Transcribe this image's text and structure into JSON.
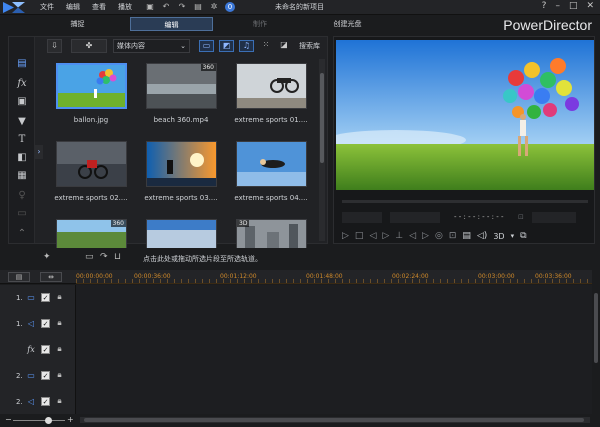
{
  "titlebar": {
    "menu": [
      "文件",
      "编辑",
      "查看",
      "播放"
    ],
    "project_title": "未命名的新项目",
    "window_buttons": [
      "?",
      "–",
      "□",
      "✕"
    ],
    "notification_count": "0"
  },
  "modes": {
    "tabs": [
      {
        "label": "捕捉",
        "state": "normal"
      },
      {
        "label": "编辑",
        "state": "active"
      },
      {
        "label": "制作",
        "state": "disabled"
      },
      {
        "label": "创建光盘",
        "state": "normal"
      }
    ],
    "brand": "PowerDirector"
  },
  "library": {
    "dropdown_value": "媒体内容",
    "search_label": "搜索库",
    "items": [
      {
        "label": "ballon.jpg",
        "badge": "",
        "selected": true
      },
      {
        "label": "beach 360.mp4",
        "badge": "360",
        "selected": false
      },
      {
        "label": "extreme sports 01....",
        "badge": "",
        "selected": false
      },
      {
        "label": "extreme sports 02....",
        "badge": "",
        "selected": false
      },
      {
        "label": "extreme sports 03....",
        "badge": "",
        "selected": false
      },
      {
        "label": "extreme sports 04....",
        "badge": "",
        "selected": false
      },
      {
        "label": "",
        "badge": "360",
        "selected": false
      },
      {
        "label": "",
        "badge": "",
        "selected": false
      },
      {
        "label": "",
        "badge": "3D",
        "selected": false
      }
    ]
  },
  "preview": {
    "timecode": "- - : - - : - - : - -",
    "mode_3d": "3D"
  },
  "timeline": {
    "hint": "点击此处或拖动所选片段至所选轨道。",
    "ruler_labels": [
      "00:00:00:00",
      "00:00:36:00",
      "00:01:12:00",
      "00:01:48:00",
      "00:02:24:00",
      "00:03:00:00",
      "00:03:36:00"
    ],
    "tracks": [
      {
        "num": "1.",
        "icon": "video-track-icon",
        "glyph": "▭"
      },
      {
        "num": "1.",
        "icon": "audio-track-icon",
        "glyph": "◁"
      },
      {
        "num": "",
        "icon": "fx-track-icon",
        "glyph": "fx"
      },
      {
        "num": "2.",
        "icon": "video-track-icon",
        "glyph": "▭"
      },
      {
        "num": "2.",
        "icon": "audio-track-icon",
        "glyph": "◁"
      }
    ]
  },
  "colors": {
    "accent": "#4d8ff2",
    "ruler_text": "#d08a2a",
    "active_tab_bg": "#2a3c55"
  }
}
